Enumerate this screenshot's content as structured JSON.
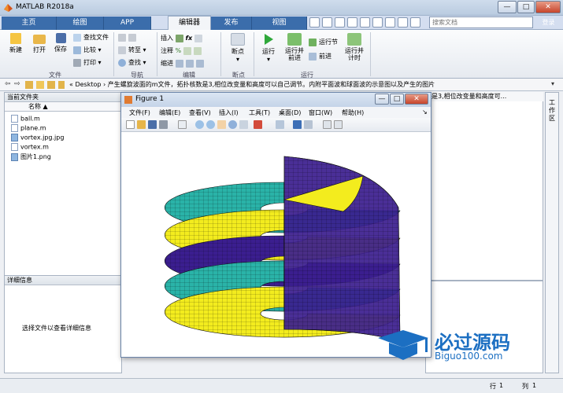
{
  "window": {
    "title": "MATLAB R2018a",
    "min": "—",
    "max": "□",
    "close": "✕"
  },
  "tabs": [
    "主页",
    "绘图",
    "APP",
    "编辑器",
    "发布",
    "视图"
  ],
  "active_tab": "编辑器",
  "search": {
    "placeholder": "搜索文档"
  },
  "login": "登录",
  "ribbon": {
    "file_group": {
      "new": "新建",
      "open": "打开",
      "save": "保存",
      "find_files": "查找文件",
      "compare": "比较",
      "print": "打印",
      "label": "文件"
    },
    "nav_group": {
      "goto": "转至",
      "find": "查找",
      "label": "导航"
    },
    "edit_group": {
      "insert": "插入",
      "comment": "注释",
      "indent": "缩进",
      "label": "编辑"
    },
    "bp_group": {
      "breakpoints": "断点",
      "label": "断点"
    },
    "run_group": {
      "run": "运行",
      "run_advance": "运行并前进",
      "run_section": "运行节",
      "advance": "前进",
      "run_time": "运行并计时",
      "label": "运行"
    }
  },
  "address": {
    "path": "«  Desktop  ›  产生螺旋波面的m文件，拓扑核数是3,相位改变量和高度可以自己调节。内附平面波和球面波的示意图以及产生的图片"
  },
  "current_folder": {
    "title": "当前文件夹",
    "column": "名称 ▲",
    "files": [
      {
        "name": "ball.m",
        "icon": "m-file-icon"
      },
      {
        "name": "plane.m",
        "icon": "m-file-icon"
      },
      {
        "name": "vortex.jpg.jpg",
        "icon": "image-file-icon"
      },
      {
        "name": "vortex.m",
        "icon": "m-file-icon"
      },
      {
        "name": "图片1.png",
        "icon": "image-file-icon"
      }
    ]
  },
  "details": {
    "title": "详细信息",
    "hint": "选择文件以查看详细信息"
  },
  "editor_header": "数是3,相位改变量和高度可...",
  "workspace_vertical": "工作区",
  "figure": {
    "title": "Figure 1",
    "menu": [
      "文件(F)",
      "编辑(E)",
      "查看(V)",
      "插入(I)",
      "工具(T)",
      "桌面(D)",
      "窗口(W)",
      "帮助(H)"
    ],
    "colors": {
      "purple": "#3b1e8f",
      "teal": "#2ab3a8",
      "yellow": "#f3ec1e"
    }
  },
  "status": {
    "row_label": "行",
    "row": "1",
    "col_label": "列",
    "col": "1"
  },
  "watermark": {
    "brand": "必过源码",
    "url": "Biguo100.com"
  }
}
